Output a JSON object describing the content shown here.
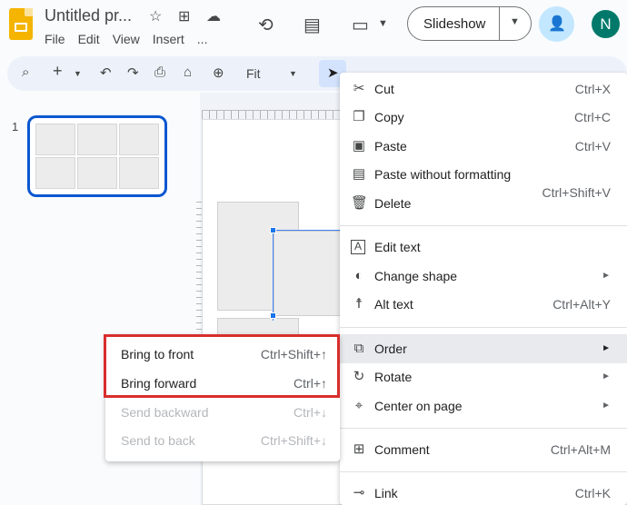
{
  "header": {
    "doc_title": "Untitled pr...",
    "menus": [
      "File",
      "Edit",
      "View",
      "Insert",
      "..."
    ],
    "slideshow_label": "Slideshow",
    "avatar_letter": "N"
  },
  "toolbar": {
    "zoom_label": "Fit"
  },
  "filmstrip": {
    "slide_number": "1"
  },
  "context_menu": {
    "items": [
      {
        "label": "Cut",
        "shortcut": "Ctrl+X",
        "icon": "scissors-icon"
      },
      {
        "label": "Copy",
        "shortcut": "Ctrl+C",
        "icon": "copy-icon"
      },
      {
        "label": "Paste",
        "shortcut": "Ctrl+V",
        "icon": "clipboard-icon"
      },
      {
        "label": "Paste without formatting",
        "shortcut": "Ctrl+Shift+V",
        "icon": "clipboard-text-icon"
      },
      {
        "label": "Delete",
        "shortcut": "",
        "icon": "trash-icon"
      },
      {
        "label": "Edit text",
        "shortcut": "",
        "icon": "text-box-icon"
      },
      {
        "label": "Change shape",
        "shortcut": "",
        "icon": "shapes-icon"
      },
      {
        "label": "Alt text",
        "shortcut": "Ctrl+Alt+Y",
        "icon": "accessibility-icon"
      },
      {
        "label": "Order",
        "shortcut": "",
        "icon": "layers-icon"
      },
      {
        "label": "Rotate",
        "shortcut": "",
        "icon": "rotate-icon"
      },
      {
        "label": "Center on page",
        "shortcut": "",
        "icon": "center-icon"
      },
      {
        "label": "Comment",
        "shortcut": "Ctrl+Alt+M",
        "icon": "comment-icon"
      },
      {
        "label": "Link",
        "shortcut": "Ctrl+K",
        "icon": "link-icon"
      }
    ]
  },
  "order_submenu": {
    "items": [
      {
        "label": "Bring to front",
        "shortcut": "Ctrl+Shift+↑",
        "enabled": true
      },
      {
        "label": "Bring forward",
        "shortcut": "Ctrl+↑",
        "enabled": true
      },
      {
        "label": "Send backward",
        "shortcut": "Ctrl+↓",
        "enabled": false
      },
      {
        "label": "Send to back",
        "shortcut": "Ctrl+Shift+↓",
        "enabled": false
      }
    ]
  },
  "colors": {
    "accent": "#0b57d0",
    "highlight_box": "#d92d2d",
    "toolbar_bg": "#edf2fa"
  }
}
